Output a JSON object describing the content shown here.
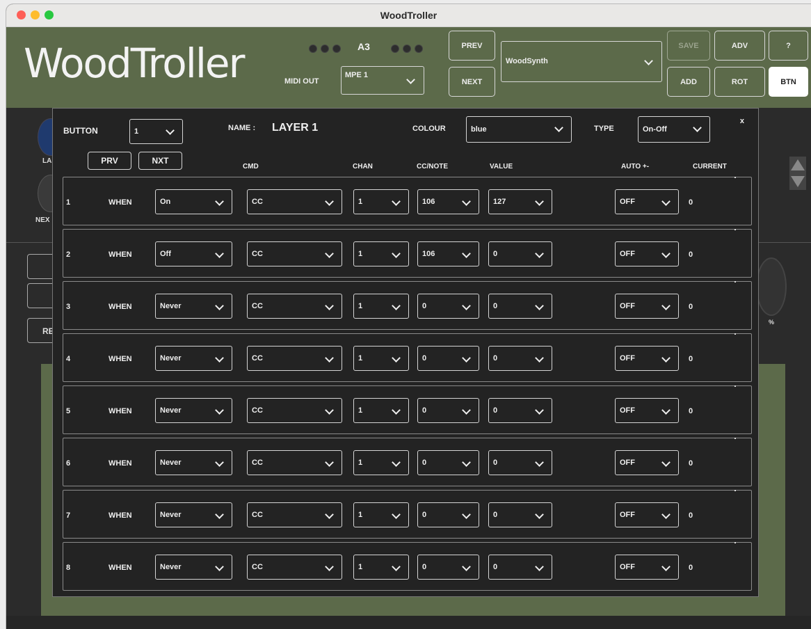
{
  "window": {
    "title": "WoodTroller"
  },
  "header": {
    "logo": "WoodTroller",
    "note": "A3",
    "midi_out_label": "MIDI OUT",
    "midi_out_value": "MPE 1",
    "prev_label": "PREV",
    "next_label": "NEXT",
    "preset_value": "WoodSynth",
    "save_label": "SAVE",
    "adv_label": "ADV",
    "help_label": "?",
    "add_label": "ADD",
    "rot_label": "ROT",
    "btn_label": "BTN"
  },
  "background": {
    "layer_label": "LA",
    "next_label": "NEX",
    "re_label": "RE",
    "percent_label": "%"
  },
  "dialog": {
    "button_label": "BUTTON",
    "button_value": "1",
    "name_label": "NAME :",
    "name_value": "LAYER 1",
    "colour_label": "COLOUR",
    "colour_value": "blue",
    "type_label": "TYPE",
    "type_value": "On-Off",
    "close_label": "x",
    "prv_label": "PRV",
    "nxt_label": "NXT",
    "columns": {
      "cmd": "CMD",
      "chan": "CHAN",
      "cc_note": "CC/NOTE",
      "value": "VALUE",
      "auto": "AUTO +-",
      "current": "CURRENT"
    },
    "rows": [
      {
        "num": "1",
        "when_label": "WHEN",
        "when": "On",
        "cmd": "CC",
        "chan": "1",
        "cc_note": "106",
        "value": "127",
        "auto": "OFF",
        "current": "0"
      },
      {
        "num": "2",
        "when_label": "WHEN",
        "when": "Off",
        "cmd": "CC",
        "chan": "1",
        "cc_note": "106",
        "value": "0",
        "auto": "OFF",
        "current": "0"
      },
      {
        "num": "3",
        "when_label": "WHEN",
        "when": "Never",
        "cmd": "CC",
        "chan": "1",
        "cc_note": "0",
        "value": "0",
        "auto": "OFF",
        "current": "0"
      },
      {
        "num": "4",
        "when_label": "WHEN",
        "when": "Never",
        "cmd": "CC",
        "chan": "1",
        "cc_note": "0",
        "value": "0",
        "auto": "OFF",
        "current": "0"
      },
      {
        "num": "5",
        "when_label": "WHEN",
        "when": "Never",
        "cmd": "CC",
        "chan": "1",
        "cc_note": "0",
        "value": "0",
        "auto": "OFF",
        "current": "0"
      },
      {
        "num": "6",
        "when_label": "WHEN",
        "when": "Never",
        "cmd": "CC",
        "chan": "1",
        "cc_note": "0",
        "value": "0",
        "auto": "OFF",
        "current": "0"
      },
      {
        "num": "7",
        "when_label": "WHEN",
        "when": "Never",
        "cmd": "CC",
        "chan": "1",
        "cc_note": "0",
        "value": "0",
        "auto": "OFF",
        "current": "0"
      },
      {
        "num": "8",
        "when_label": "WHEN",
        "when": "Never",
        "cmd": "CC",
        "chan": "1",
        "cc_note": "0",
        "value": "0",
        "auto": "OFF",
        "current": "0"
      }
    ]
  },
  "colors": {
    "header_bg": "#5c6a4a",
    "panel_bg": "#232323",
    "accent_active": "#ffffff"
  }
}
